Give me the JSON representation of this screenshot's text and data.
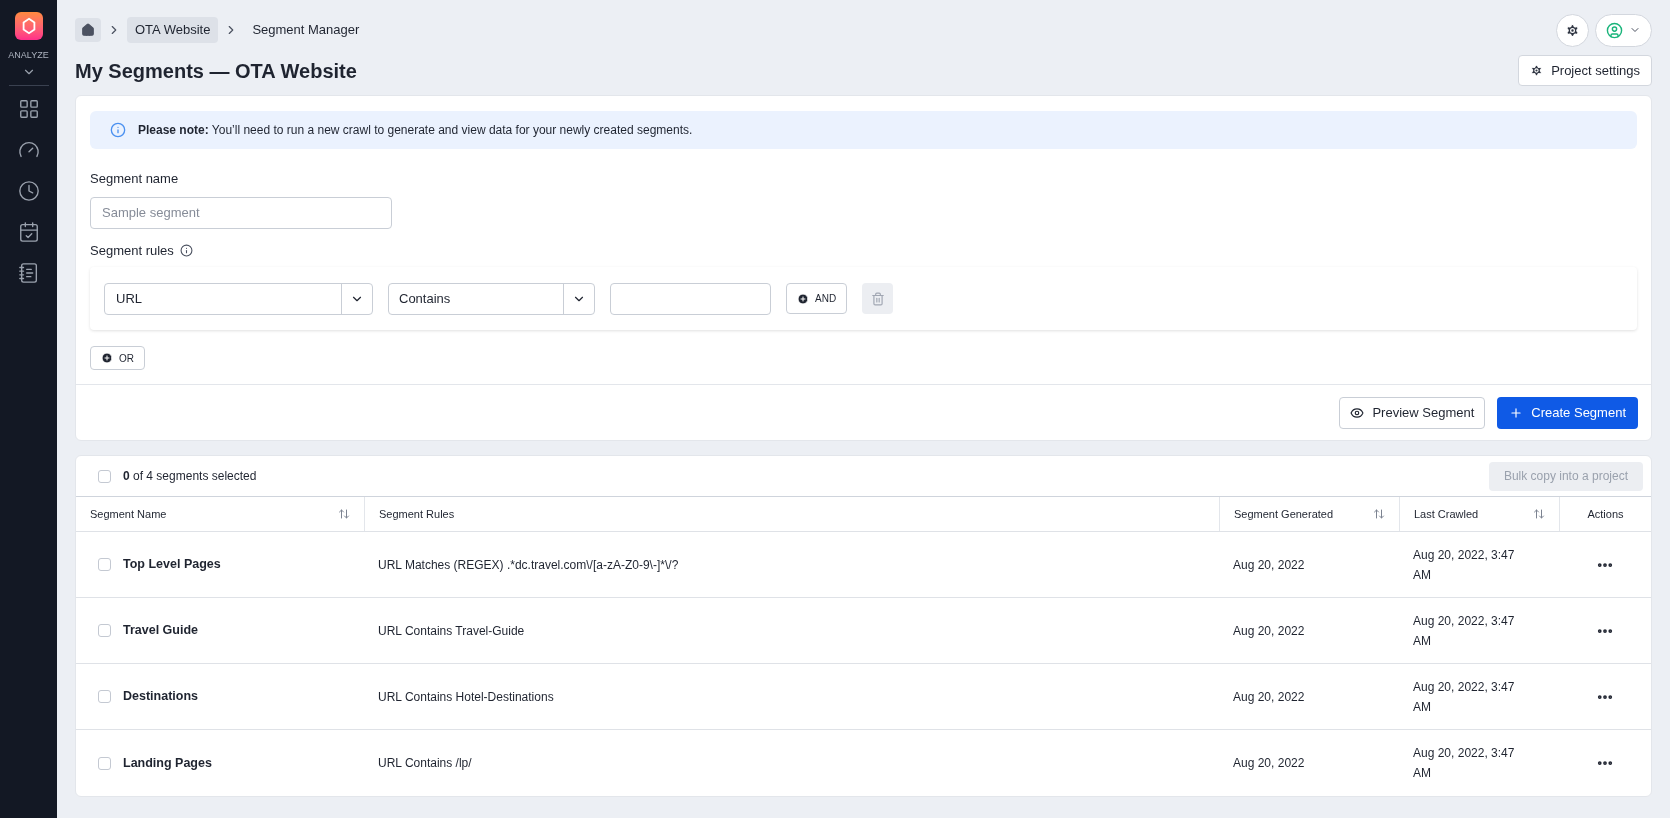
{
  "sidebar": {
    "section_label": "ANALYZE"
  },
  "breadcrumb": [
    "OTA Website",
    "Segment Manager"
  ],
  "page_title": "My Segments — OTA Website",
  "project_settings_button": "Project settings",
  "notice": "**Please note:** You’ll need to run a new crawl to generate and view data for your newly created segments.",
  "segment_name": {
    "label": "Segment name",
    "placeholder": "Sample segment"
  },
  "segment_rules": {
    "label": "Segment rules",
    "field": "URL",
    "operator": "Contains",
    "and_button": "AND",
    "or_button": "OR"
  },
  "preview_button": "Preview Segment",
  "create_button": "Create Segment",
  "table": {
    "select_all_checked": false,
    "selection_summary": "**0** of 4 segments selected",
    "bulk_copy_button": {
      "label": "Bulk copy into a project",
      "disabled": true
    },
    "columns": [
      {
        "label": "Segment Name",
        "sortable": true
      },
      {
        "label": "Segment Rules",
        "sortable": false
      },
      {
        "label": "Segment Generated",
        "sortable": true
      },
      {
        "label": "Last Crawled",
        "sortable": true
      },
      {
        "label": "Actions",
        "sortable": false
      }
    ],
    "rows": [
      {
        "checked": false,
        "name": "Top Level Pages",
        "rules": "URL Matches (REGEX) .*dc.travel.com\\/[a-zA-Z0-9\\-]*\\/?",
        "generated": "Aug 20, 2022",
        "last_crawled": "Aug 20, 2022, 3:47 AM"
      },
      {
        "checked": false,
        "name": "Travel Guide",
        "rules": "URL Contains Travel-Guide",
        "generated": "Aug 20, 2022",
        "last_crawled": "Aug 20, 2022, 3:47 AM"
      },
      {
        "checked": false,
        "name": "Destinations",
        "rules": "URL Contains Hotel-Destinations",
        "generated": "Aug 20, 2022",
        "last_crawled": "Aug 20, 2022, 3:47 AM"
      },
      {
        "checked": false,
        "name": "Landing Pages",
        "rules": "URL Contains /lp/",
        "generated": "Aug 20, 2022",
        "last_crawled": "Aug 20, 2022, 3:47 AM"
      }
    ]
  }
}
